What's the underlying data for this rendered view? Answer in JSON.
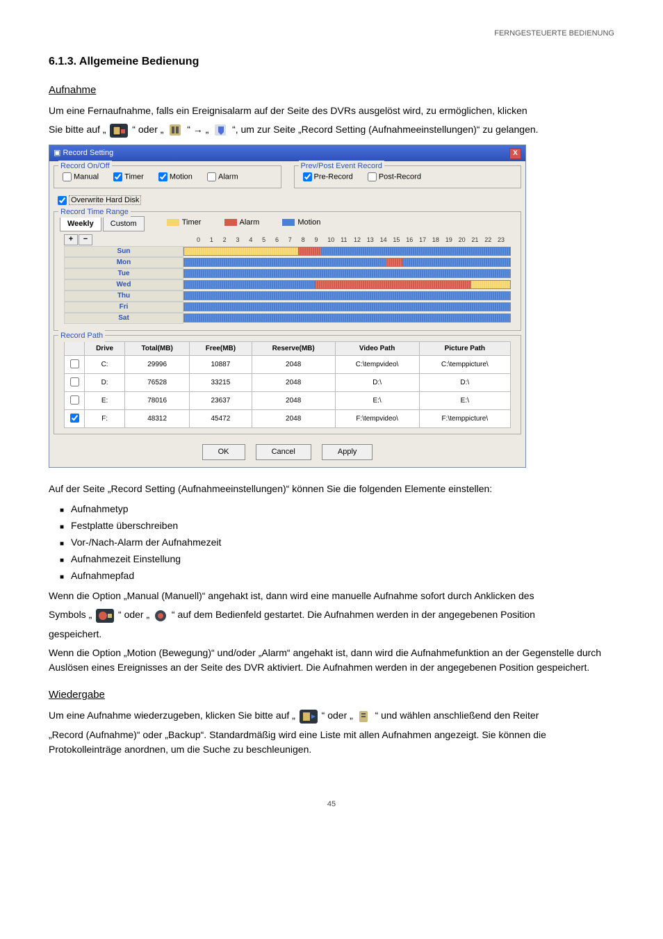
{
  "header": {
    "right": "FERNGESTEUERTE BEDIENUNG"
  },
  "section": {
    "number_title": "6.1.3. Allgemeine Bedienung",
    "aufnahme_h": "Aufnahme",
    "p1": "Um eine Fernaufnahme, falls ein Ereignisalarm auf der Seite des DVRs ausgelöst wird, zu ermöglichen, klicken",
    "p2_a": "Sie bitte auf „",
    "p2_b": "“ oder „",
    "p2_c": "“ → „",
    "p2_d": "“, um zur Seite „Record Setting (Aufnahmeeinstellungen)“ zu gelangen.",
    "after_dialog": "Auf der Seite „Record Setting (Aufnahmeeinstellungen)“ können Sie die folgenden Elemente einstellen:",
    "bullets": [
      "Aufnahmetyp",
      "Festplatte überschreiben",
      "Vor-/Nach-Alarm der Aufnahmezeit",
      "Aufnahmezeit Einstellung",
      "Aufnahmepfad"
    ],
    "p3_a": "Wenn die Option „Manual (Manuell)“ angehakt ist, dann wird eine manuelle Aufnahme sofort durch Anklicken des",
    "p4_a": "Symbols „",
    "p4_b": "“ oder „",
    "p4_c": "“ auf dem Bedienfeld gestartet. Die Aufnahmen werden in der angegebenen Position",
    "p4_d": "gespeichert.",
    "p5": "Wenn die Option „Motion (Bewegung)“ und/oder „Alarm“ angehakt ist, dann wird die Aufnahmefunktion an der Gegenstelle durch Auslösen eines Ereignisses an der Seite des DVR aktiviert. Die Aufnahmen werden in der angegebenen Position gespeichert.",
    "wiedergabe_h": "Wiedergabe",
    "p6_a": "Um eine Aufnahme wiederzugeben, klicken Sie bitte auf „",
    "p6_b": "“ oder „",
    "p6_c": "“ und wählen anschließend den Reiter",
    "p7": "„Record (Aufnahme)“ oder „Backup“. Standardmäßig wird eine Liste mit allen Aufnahmen angezeigt. Sie können die Protokolleinträge anordnen, um die Suche zu beschleunigen."
  },
  "dialog": {
    "title": "Record Setting",
    "record_onoff": "Record On/Off",
    "manual": "Manual",
    "timer": "Timer",
    "motion": "Motion",
    "alarm": "Alarm",
    "prevpost": "Prev/Post Event Record",
    "prerecord": "Pre-Record",
    "postrecord": "Post-Record",
    "overwrite": "Overwrite Hard Disk",
    "timerange": "Record Time Range",
    "weekly": "Weekly",
    "custom": "Custom",
    "leg_timer": "Timer",
    "leg_alarm": "Alarm",
    "leg_motion": "Motion",
    "days": [
      "Sun",
      "Mon",
      "Tue",
      "Wed",
      "Thu",
      "Fri",
      "Sat"
    ],
    "recordpath": "Record Path",
    "cols": [
      "Drive",
      "Total(MB)",
      "Free(MB)",
      "Reserve(MB)",
      "Video Path",
      "Picture Path"
    ],
    "rows": [
      {
        "chk": false,
        "drive": "C:",
        "total": "29996",
        "free": "10887",
        "reserve": "2048",
        "vpath": "C:\\tempvideo\\",
        "ppath": "C:\\temppicture\\"
      },
      {
        "chk": false,
        "drive": "D:",
        "total": "76528",
        "free": "33215",
        "reserve": "2048",
        "vpath": "D:\\",
        "ppath": "D:\\"
      },
      {
        "chk": false,
        "drive": "E:",
        "total": "78016",
        "free": "23637",
        "reserve": "2048",
        "vpath": "E:\\",
        "ppath": "E:\\"
      },
      {
        "chk": true,
        "drive": "F:",
        "total": "48312",
        "free": "45472",
        "reserve": "2048",
        "vpath": "F:\\tempvideo\\",
        "ppath": "F:\\temppicture\\"
      }
    ],
    "ok": "OK",
    "cancel": "Cancel",
    "apply": "Apply"
  },
  "pagenum": "45"
}
